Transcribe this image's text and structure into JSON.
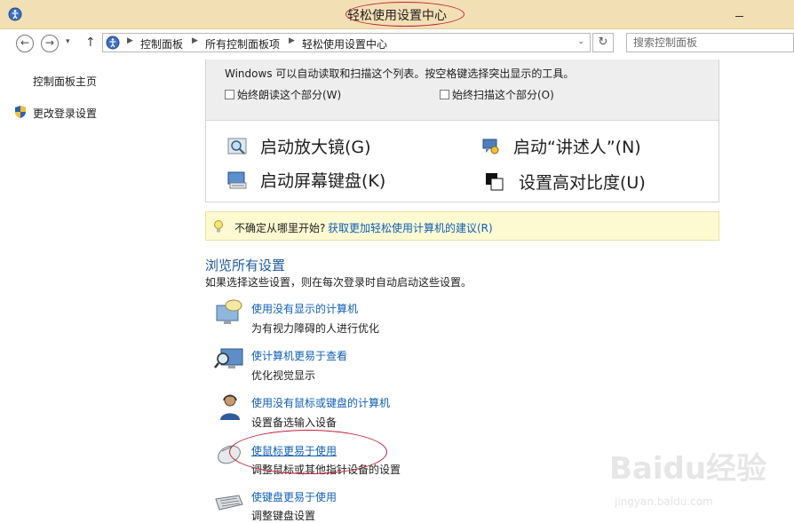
{
  "window": {
    "title": "轻松使用设置中心"
  },
  "nav": {
    "back_glyph": "←",
    "forward_glyph": "→",
    "recent_glyph": "▾",
    "up_glyph": "↑",
    "breadcrumbs": [
      "控制面板",
      "所有控制面板项",
      "轻松使用设置中心"
    ],
    "crumb_sep_glyph": "▶",
    "address_drop_glyph": "⌄",
    "refresh_glyph": "↻",
    "search_placeholder": "搜索控制面板"
  },
  "sidebar": {
    "home_link": "控制面板主页",
    "login_settings_link": "更改登录设置"
  },
  "quick_access": {
    "intro": "Windows 可以自动读取和扫描这个列表。按空格键选择突出显示的工具。",
    "checkbox_read": "始终朗读这个部分(W)",
    "checkbox_scan": "始终扫描这个部分(O)",
    "tools": {
      "magnifier": "启动放大镜(G)",
      "narrator": "启动“讲述人”(N)",
      "keyboard": "启动屏幕键盘(K)",
      "contrast": "设置高对比度(U)"
    }
  },
  "tip": {
    "question": "不确定从哪里开始?",
    "link": "获取更加轻松使用计算机的建议(R)"
  },
  "browse": {
    "heading": "浏览所有设置",
    "description": "如果选择这些设置，则在每次登录时自动启动这些设置。",
    "items": [
      {
        "link": "使用没有显示的计算机",
        "desc": "为有视力障碍的人进行优化"
      },
      {
        "link": "使计算机更易于查看",
        "desc": "优化视觉显示"
      },
      {
        "link": "使用没有鼠标或键盘的计算机",
        "desc": "设置备选输入设备"
      },
      {
        "link": "使鼠标更易于使用",
        "desc": "调整鼠标或其他指针设备的设置"
      },
      {
        "link": "使键盘更易于使用",
        "desc": "调整键盘设置"
      }
    ]
  },
  "watermark": {
    "logo": "Baidu经验",
    "url": "jingyan.baidu.com"
  },
  "colors": {
    "titlebar": "#f3dfb4",
    "link": "#0f5fb8",
    "heading": "#1e5aa0",
    "annotation": "#c0203a",
    "tip_bg": "#fdfad2"
  }
}
